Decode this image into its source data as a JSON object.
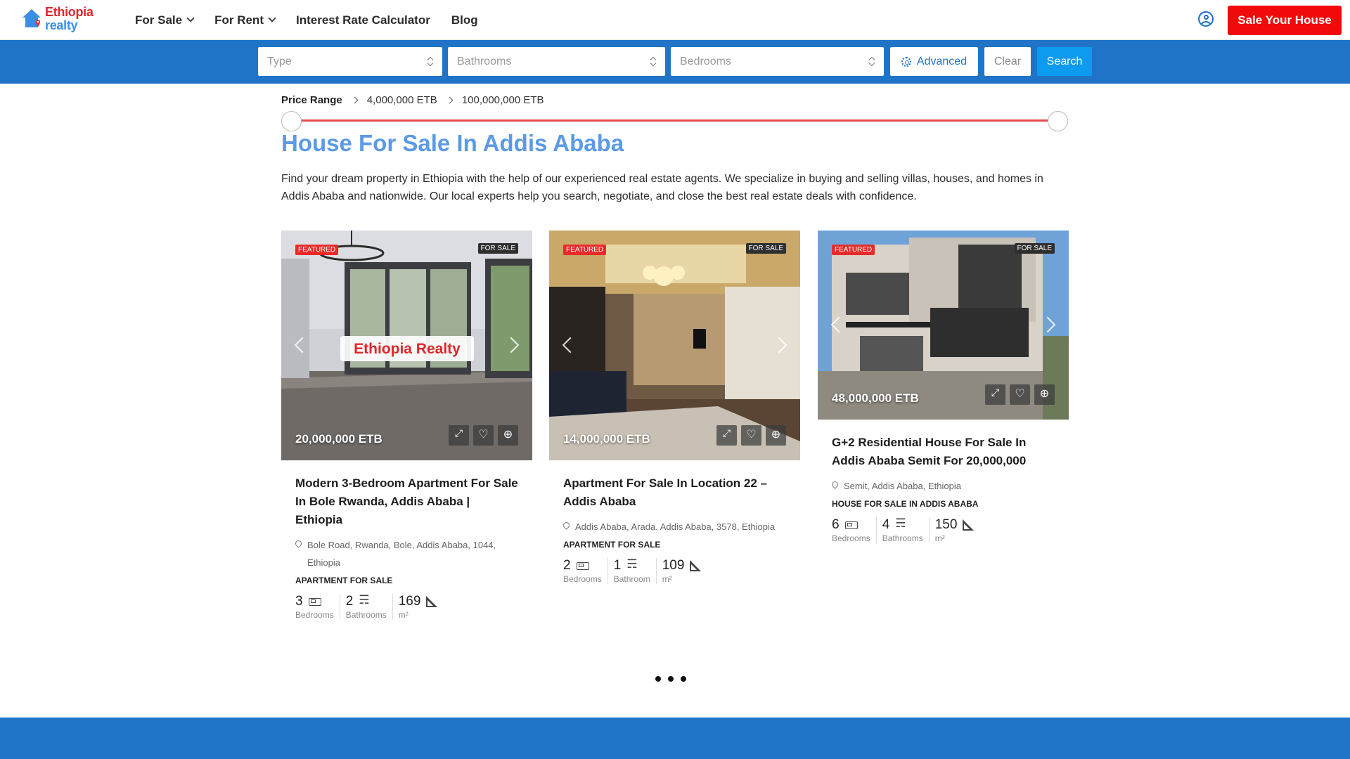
{
  "header": {
    "logo_line1": "Ethiopia",
    "logo_line2": "realty",
    "nav": [
      "For Sale",
      "For Rent",
      "Interest Rate Calculator",
      "Blog"
    ],
    "sell_button": "Sale Your House"
  },
  "search": {
    "type_placeholder": "Type",
    "bathrooms_placeholder": "Bathrooms",
    "bedrooms_placeholder": "Bedrooms",
    "advanced": "Advanced",
    "clear": "Clear",
    "search": "Search"
  },
  "price_range": {
    "label": "Price Range",
    "min": "4,000,000 ETB",
    "max": "100,000,000 ETB"
  },
  "page": {
    "title": "House For Sale In Addis Ababa",
    "intro": "Find your dream property in Ethiopia with the help of our experienced real estate agents. We specialize in buying and selling villas, houses, and homes in Addis Ababa and nationwide. Our local experts help you search, negotiate, and close the best real estate deals with confidence."
  },
  "cards": [
    {
      "featured": "FEATURED",
      "status": "FOR SALE",
      "price": "20,000,000 ETB",
      "title": "Modern 3-Bedroom Apartment For Sale In Bole Rwanda, Addis Ababa | Ethiopia",
      "address": "Bole Road, Rwanda, Bole, Addis Ababa, 1044, Ethiopia",
      "category": "APARTMENT FOR SALE",
      "watermark": "Ethiopia Realty",
      "features": [
        {
          "value": "3",
          "label": "Bedrooms"
        },
        {
          "value": "2",
          "label": "Bathrooms"
        },
        {
          "value": "169",
          "label": "m²"
        }
      ]
    },
    {
      "featured": "FEATURED",
      "status": "FOR SALE",
      "price": "14,000,000 ETB",
      "title": "Apartment For Sale In Location 22 – Addis Ababa",
      "address": "Addis Ababa, Arada, Addis Ababa, 3578, Ethiopia",
      "category": "APARTMENT FOR SALE",
      "features": [
        {
          "value": "2",
          "label": "Bedrooms"
        },
        {
          "value": "1",
          "label": "Bathroom"
        },
        {
          "value": "109",
          "label": "m²"
        }
      ]
    },
    {
      "featured": "FEATURED",
      "status": "FOR SALE",
      "price": "48,000,000 ETB",
      "title": "G+2 Residential House For Sale In Addis Ababa Semit For 20,000,000",
      "address": "Semit, Addis Ababa, Ethiopia",
      "category": "HOUSE FOR SALE IN ADDIS ABABA",
      "features": [
        {
          "value": "6",
          "label": "Bedrooms"
        },
        {
          "value": "4",
          "label": "Bathrooms"
        },
        {
          "value": "150",
          "label": "m²"
        }
      ]
    }
  ],
  "colors": {
    "brand_blue": "#1f74c8",
    "brand_red": "#f00a0a",
    "title_blue": "#5b9ae6",
    "search_blue": "#0d9bf0"
  }
}
